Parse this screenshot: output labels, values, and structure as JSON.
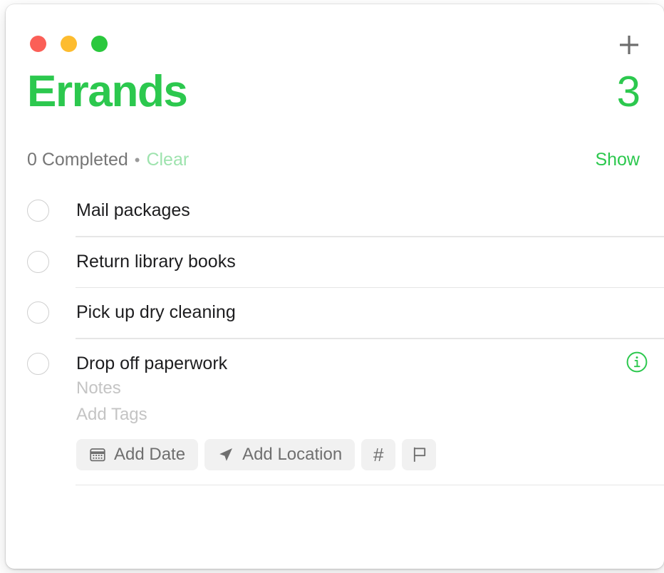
{
  "window": {
    "traffic_lights": [
      {
        "name": "close",
        "color": "#fb5f57"
      },
      {
        "name": "minimize",
        "color": "#fdbc2f"
      },
      {
        "name": "zoom",
        "color": "#2ac83d"
      }
    ],
    "add_button_icon": "plus-icon"
  },
  "header": {
    "title": "Errands",
    "count": "3",
    "completed_text": "0 Completed",
    "separator": "•",
    "clear_label": "Clear",
    "show_label": "Show",
    "accent_color": "#2cc84e",
    "clear_disabled_color": "#9ee3ae"
  },
  "tasks": [
    {
      "title": "Mail packages",
      "completed": false,
      "expanded": false
    },
    {
      "title": "Return library books",
      "completed": false,
      "expanded": false
    },
    {
      "title": "Pick up dry cleaning",
      "completed": false,
      "expanded": false
    },
    {
      "title": "Drop off paperwork",
      "completed": false,
      "expanded": true,
      "notes_placeholder": "Notes",
      "tags_placeholder": "Add Tags",
      "chips": [
        {
          "icon": "calendar-icon",
          "label": "Add Date"
        },
        {
          "icon": "location-arrow-icon",
          "label": "Add Location"
        },
        {
          "icon": "hashtag-icon",
          "label": "#"
        },
        {
          "icon": "flag-icon",
          "label": ""
        }
      ],
      "info_icon": "info-circle-icon"
    }
  ]
}
